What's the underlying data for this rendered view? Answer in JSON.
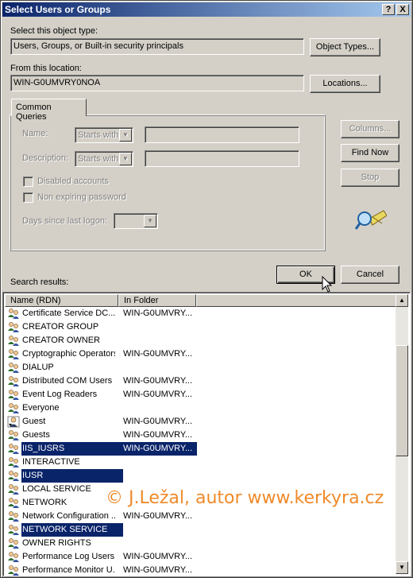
{
  "window": {
    "title": "Select Users or Groups",
    "help_label": "?",
    "close_label": "X"
  },
  "object_type": {
    "label": "Select this object type:",
    "value": "Users, Groups, or Built-in security principals",
    "button": "Object Types..."
  },
  "location": {
    "label": "From this location:",
    "value": "WIN-G0UMVRY0NOA",
    "button": "Locations..."
  },
  "common_queries": {
    "tab_label": "Common Queries",
    "name_label": "Name:",
    "name_mode": "Starts with",
    "description_label": "Description:",
    "description_mode": "Starts with",
    "disabled_accounts_label": "Disabled accounts",
    "non_expiring_password_label": "Non expiring password",
    "days_since_logon_label": "Days since last logon:",
    "columns_button": "Columns...",
    "find_now_button": "Find Now",
    "stop_button": "Stop"
  },
  "actions": {
    "ok_button": "OK",
    "cancel_button": "Cancel"
  },
  "results": {
    "label": "Search results:",
    "columns": [
      "Name (RDN)",
      "In Folder"
    ],
    "rows": [
      {
        "name": "Certificate Service DC...",
        "folder": "WIN-G0UMVRY...",
        "icon": "group-icon",
        "selected": false
      },
      {
        "name": "CREATOR GROUP",
        "folder": "",
        "icon": "group-icon",
        "selected": false
      },
      {
        "name": "CREATOR OWNER",
        "folder": "",
        "icon": "group-icon",
        "selected": false
      },
      {
        "name": "Cryptographic Operators",
        "folder": "WIN-G0UMVRY...",
        "icon": "group-icon",
        "selected": false
      },
      {
        "name": "DIALUP",
        "folder": "",
        "icon": "group-icon",
        "selected": false
      },
      {
        "name": "Distributed COM Users",
        "folder": "WIN-G0UMVRY...",
        "icon": "group-icon",
        "selected": false
      },
      {
        "name": "Event Log Readers",
        "folder": "WIN-G0UMVRY...",
        "icon": "group-icon",
        "selected": false
      },
      {
        "name": "Everyone",
        "folder": "",
        "icon": "group-icon",
        "selected": false
      },
      {
        "name": "Guest",
        "folder": "WIN-G0UMVRY...",
        "icon": "guest-user-icon",
        "selected": false
      },
      {
        "name": "Guests",
        "folder": "WIN-G0UMVRY...",
        "icon": "group-icon",
        "selected": false
      },
      {
        "name": "IIS_IUSRS",
        "folder": "WIN-G0UMVRY...",
        "icon": "group-icon",
        "selected": true
      },
      {
        "name": "INTERACTIVE",
        "folder": "",
        "icon": "group-icon",
        "selected": false
      },
      {
        "name": "IUSR",
        "folder": "",
        "icon": "group-icon",
        "selected": true
      },
      {
        "name": "LOCAL SERVICE",
        "folder": "",
        "icon": "group-icon",
        "selected": false
      },
      {
        "name": "NETWORK",
        "folder": "",
        "icon": "group-icon",
        "selected": false
      },
      {
        "name": "Network Configuration ...",
        "folder": "WIN-G0UMVRY...",
        "icon": "group-icon",
        "selected": false
      },
      {
        "name": "NETWORK SERVICE",
        "folder": "",
        "icon": "group-icon",
        "selected": true
      },
      {
        "name": "OWNER RIGHTS",
        "folder": "",
        "icon": "group-icon",
        "selected": false
      },
      {
        "name": "Performance Log Users",
        "folder": "WIN-G0UMVRY...",
        "icon": "group-icon",
        "selected": false
      },
      {
        "name": "Performance Monitor U...",
        "folder": "WIN-G0UMVRY...",
        "icon": "group-icon",
        "selected": false
      }
    ]
  },
  "watermark": "© J.Ležal, autor www.kerkyra.cz",
  "colors": {
    "titlebar_start": "#0a246a",
    "titlebar_end": "#a6caf0",
    "selection": "#0a246a",
    "watermark": "#f08a2a",
    "face": "#d4d0c8"
  }
}
